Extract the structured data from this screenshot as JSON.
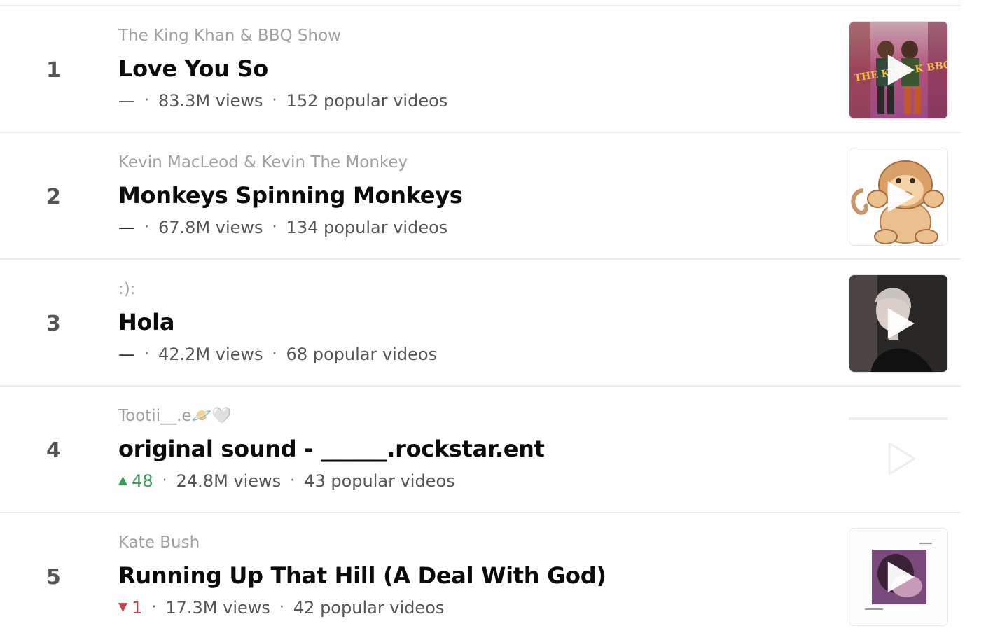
{
  "songs": [
    {
      "rank": "1",
      "artist": "The King Khan & BBQ Show",
      "title": "Love You So",
      "trend": {
        "direction": "flat",
        "symbol": "—",
        "value": ""
      },
      "views": "83.3M views",
      "popular": "152 popular videos",
      "thumbnail": "album-art-king-khan"
    },
    {
      "rank": "2",
      "artist": "Kevin MacLeod & Kevin The Monkey",
      "title": "Monkeys Spinning Monkeys",
      "trend": {
        "direction": "flat",
        "symbol": "—",
        "value": ""
      },
      "views": "67.8M views",
      "popular": "134 popular videos",
      "thumbnail": "album-art-monkey"
    },
    {
      "rank": "3",
      "artist": ":):",
      "title": "Hola",
      "trend": {
        "direction": "flat",
        "symbol": "—",
        "value": ""
      },
      "views": "42.2M views",
      "popular": "68 popular videos",
      "thumbnail": "album-art-portrait"
    },
    {
      "rank": "4",
      "artist": "Tootii__.e🪐🤍",
      "title": "original sound - ______.rockstar.ent",
      "trend": {
        "direction": "up",
        "symbol": "▲",
        "value": "48"
      },
      "views": "24.8M views",
      "popular": "43 popular videos",
      "thumbnail": "album-art-empty"
    },
    {
      "rank": "5",
      "artist": "Kate Bush",
      "title": "Running Up That Hill (A Deal With God)",
      "trend": {
        "direction": "down",
        "symbol": "▼",
        "value": "1"
      },
      "views": "17.3M views",
      "popular": "42 popular videos",
      "thumbnail": "album-art-kate-bush"
    }
  ],
  "colors": {
    "trend_up": "#3b9b5a",
    "trend_down": "#c83b4a",
    "artist_text": "#a0a0a0",
    "divider": "#ececec"
  }
}
